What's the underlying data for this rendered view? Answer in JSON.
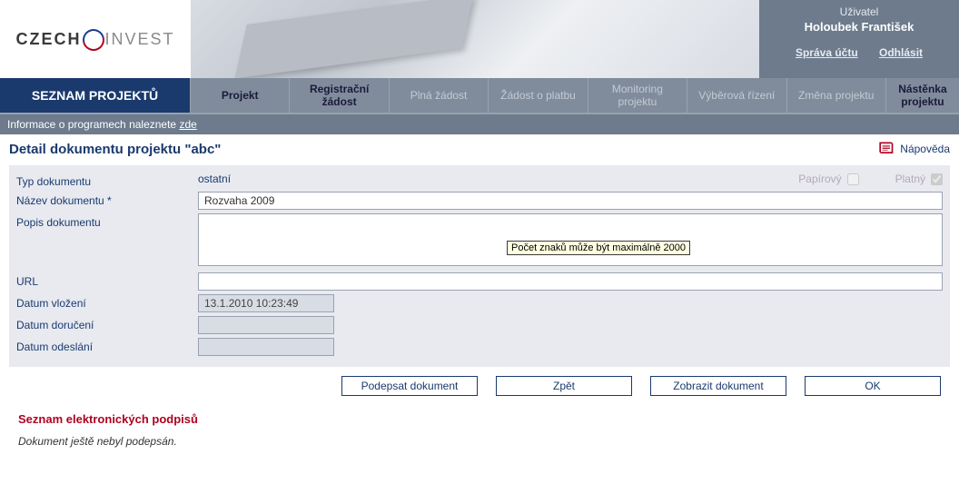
{
  "header": {
    "logo_dark": "CZECH",
    "logo_light": "INVEST",
    "user_label": "Uživatel",
    "user_name": "Holoubek František",
    "account_link": "Správa účtu",
    "logout_link": "Odhlásit"
  },
  "nav": {
    "seznam": "SEZNAM PROJEKTŮ",
    "projekt": "Projekt",
    "registracni": "Registrační žádost",
    "plna": "Plná žádost",
    "zadost_platbu": "Žádost o platbu",
    "monitoring": "Monitoring projektu",
    "vyberova": "Výběrová řízení",
    "zmena": "Změna projektu",
    "nastenka": "Nástěnka projektu"
  },
  "infobar": {
    "text": "Informace o programech naleznete ",
    "link": "zde"
  },
  "page": {
    "title": "Detail dokumentu projektu  \"abc\"",
    "help": "Nápověda"
  },
  "form": {
    "labels": {
      "typ": "Typ dokumentu",
      "nazev": "Název dokumentu *",
      "popis": "Popis dokumentu",
      "url": "URL",
      "datum_vlozeni": "Datum vložení",
      "datum_doruceni": "Datum doručení",
      "datum_odeslani": "Datum odeslání"
    },
    "values": {
      "typ": "ostatní",
      "nazev": "Rozvaha 2009",
      "popis": "",
      "url": "",
      "datum_vlozeni": "13.1.2010 10:23:49",
      "datum_doruceni": "",
      "datum_odeslani": ""
    },
    "checkboxes": {
      "papirovy_label": "Papírový",
      "papirovy_checked": false,
      "platny_label": "Platný",
      "platny_checked": true
    },
    "tooltip": "Počet znaků může být maximálně 2000"
  },
  "buttons": {
    "podepsat": "Podepsat dokument",
    "zpet": "Zpět",
    "zobrazit": "Zobrazit dokument",
    "ok": "OK"
  },
  "signatures": {
    "title": "Seznam elektronických podpisů",
    "status": "Dokument ještě nebyl podepsán."
  }
}
